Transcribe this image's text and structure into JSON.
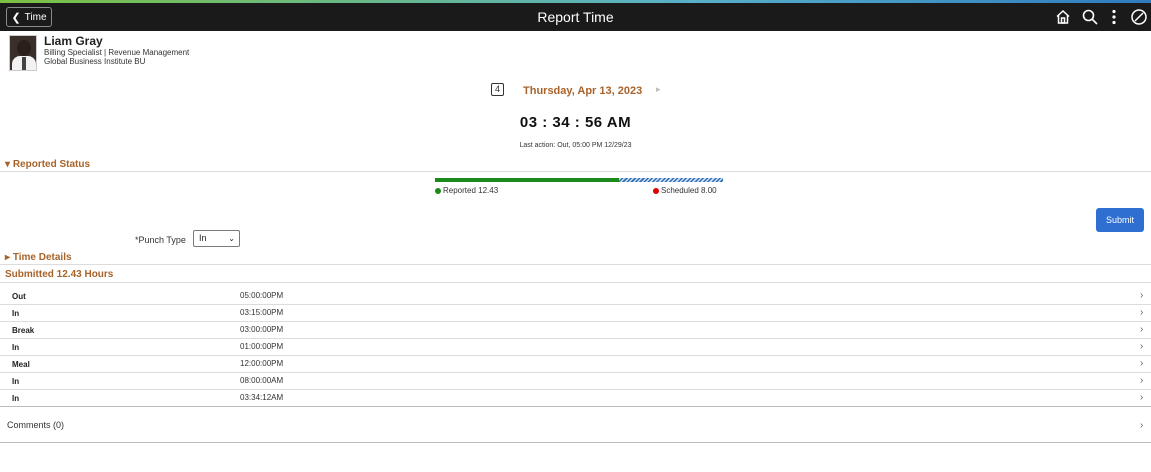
{
  "header": {
    "back_label": "Time",
    "title": "Report Time",
    "icons": [
      "home-icon",
      "search-icon",
      "more-vertical-icon",
      "compass-icon"
    ]
  },
  "profile": {
    "name": "Liam Gray",
    "role": "Billing Specialist | Revenue Management",
    "business_unit": "Global Business Institute BU"
  },
  "date_nav": {
    "date": "Thursday, Apr 13, 2023",
    "prev_glyph": "4",
    "next_glyph": "▸"
  },
  "clock": {
    "time": "03 : 34 : 56 AM",
    "last_action": "Last action: Out, 05:00 PM 12/29/23"
  },
  "reported_status": {
    "title": "Reported Status",
    "reported_label": "Reported 12.43",
    "scheduled_label": "Scheduled 8.00",
    "reported_fraction": 0.64
  },
  "submit_label": "Submit",
  "punch": {
    "label": "*Punch Type",
    "value": "In"
  },
  "time_details_title": "Time Details",
  "submitted_title": "Submitted 12.43 Hours",
  "entries": [
    {
      "type": "Out",
      "time": "05:00:00PM"
    },
    {
      "type": "In",
      "time": "03:15:00PM"
    },
    {
      "type": "Break",
      "time": "03:00:00PM"
    },
    {
      "type": "In",
      "time": "01:00:00PM"
    },
    {
      "type": "Meal",
      "time": "12:00:00PM"
    },
    {
      "type": "In",
      "time": "08:00:00AM"
    },
    {
      "type": "In",
      "time": "03:34:12AM"
    }
  ],
  "comments_label": "Comments (0)",
  "colors": {
    "accent_orange": "#a8632a",
    "reported_green": "#1a8a1a",
    "scheduled_red": "#e00000",
    "submit_blue": "#2e6fd1",
    "header_black": "#1a1a1a"
  }
}
